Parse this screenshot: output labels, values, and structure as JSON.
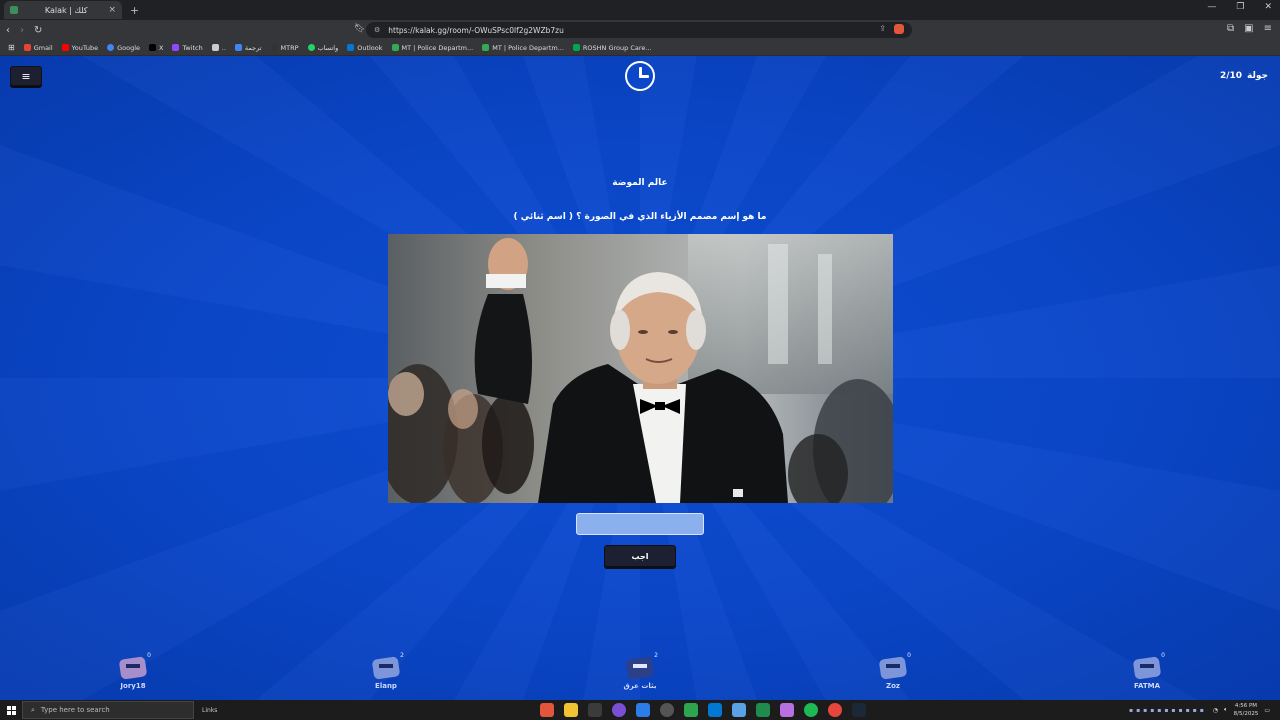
{
  "browser": {
    "tab_title": "Kalak | كلك",
    "tab_close": "×",
    "new_tab": "+",
    "url": "https://kalak.gg/room/-OWuSPsc0lf2g2WZb7zu",
    "bookmarks": [
      {
        "label": "Gmail",
        "color": "#ea4335"
      },
      {
        "label": "YouTube",
        "color": "#ff0000"
      },
      {
        "label": "Google",
        "color": "#4285f4"
      },
      {
        "label": "X",
        "color": "#000000"
      },
      {
        "label": "Twitch",
        "color": "#9146ff"
      },
      {
        "label": "..",
        "color": "#cccccc"
      },
      {
        "label": "ترجمة",
        "color": "#4285f4"
      },
      {
        "label": "MTRP",
        "color": "#333333"
      },
      {
        "label": "واتساب",
        "color": "#25d366"
      },
      {
        "label": "Outlook",
        "color": "#0078d4"
      },
      {
        "label": "MT | Police Departm...",
        "color": "#34a853"
      },
      {
        "label": "MT | Police Departm...",
        "color": "#34a853"
      },
      {
        "label": "ROSHN Group Care...",
        "color": "#00a651"
      }
    ]
  },
  "game": {
    "menu_icon": "≡",
    "round_label": "جولة",
    "round_value": "2/10",
    "category": "عالم الموضة",
    "question": "ما هو إسم مصمم الأزياء الذي في الصورة ؟ ( اسم ثنائي )",
    "answer_value": "",
    "answer_button": "اجب",
    "players": [
      {
        "name": "Jory18",
        "score": "0"
      },
      {
        "name": "Elanp",
        "score": "2"
      },
      {
        "name": "بثات عرق",
        "score": "2"
      },
      {
        "name": "Zoz",
        "score": "0"
      },
      {
        "name": "FATMA",
        "score": "0"
      }
    ]
  },
  "taskbar": {
    "search_placeholder": "Type here to search",
    "links": "Links",
    "time": "4:56 PM",
    "date": "8/5/2025"
  }
}
